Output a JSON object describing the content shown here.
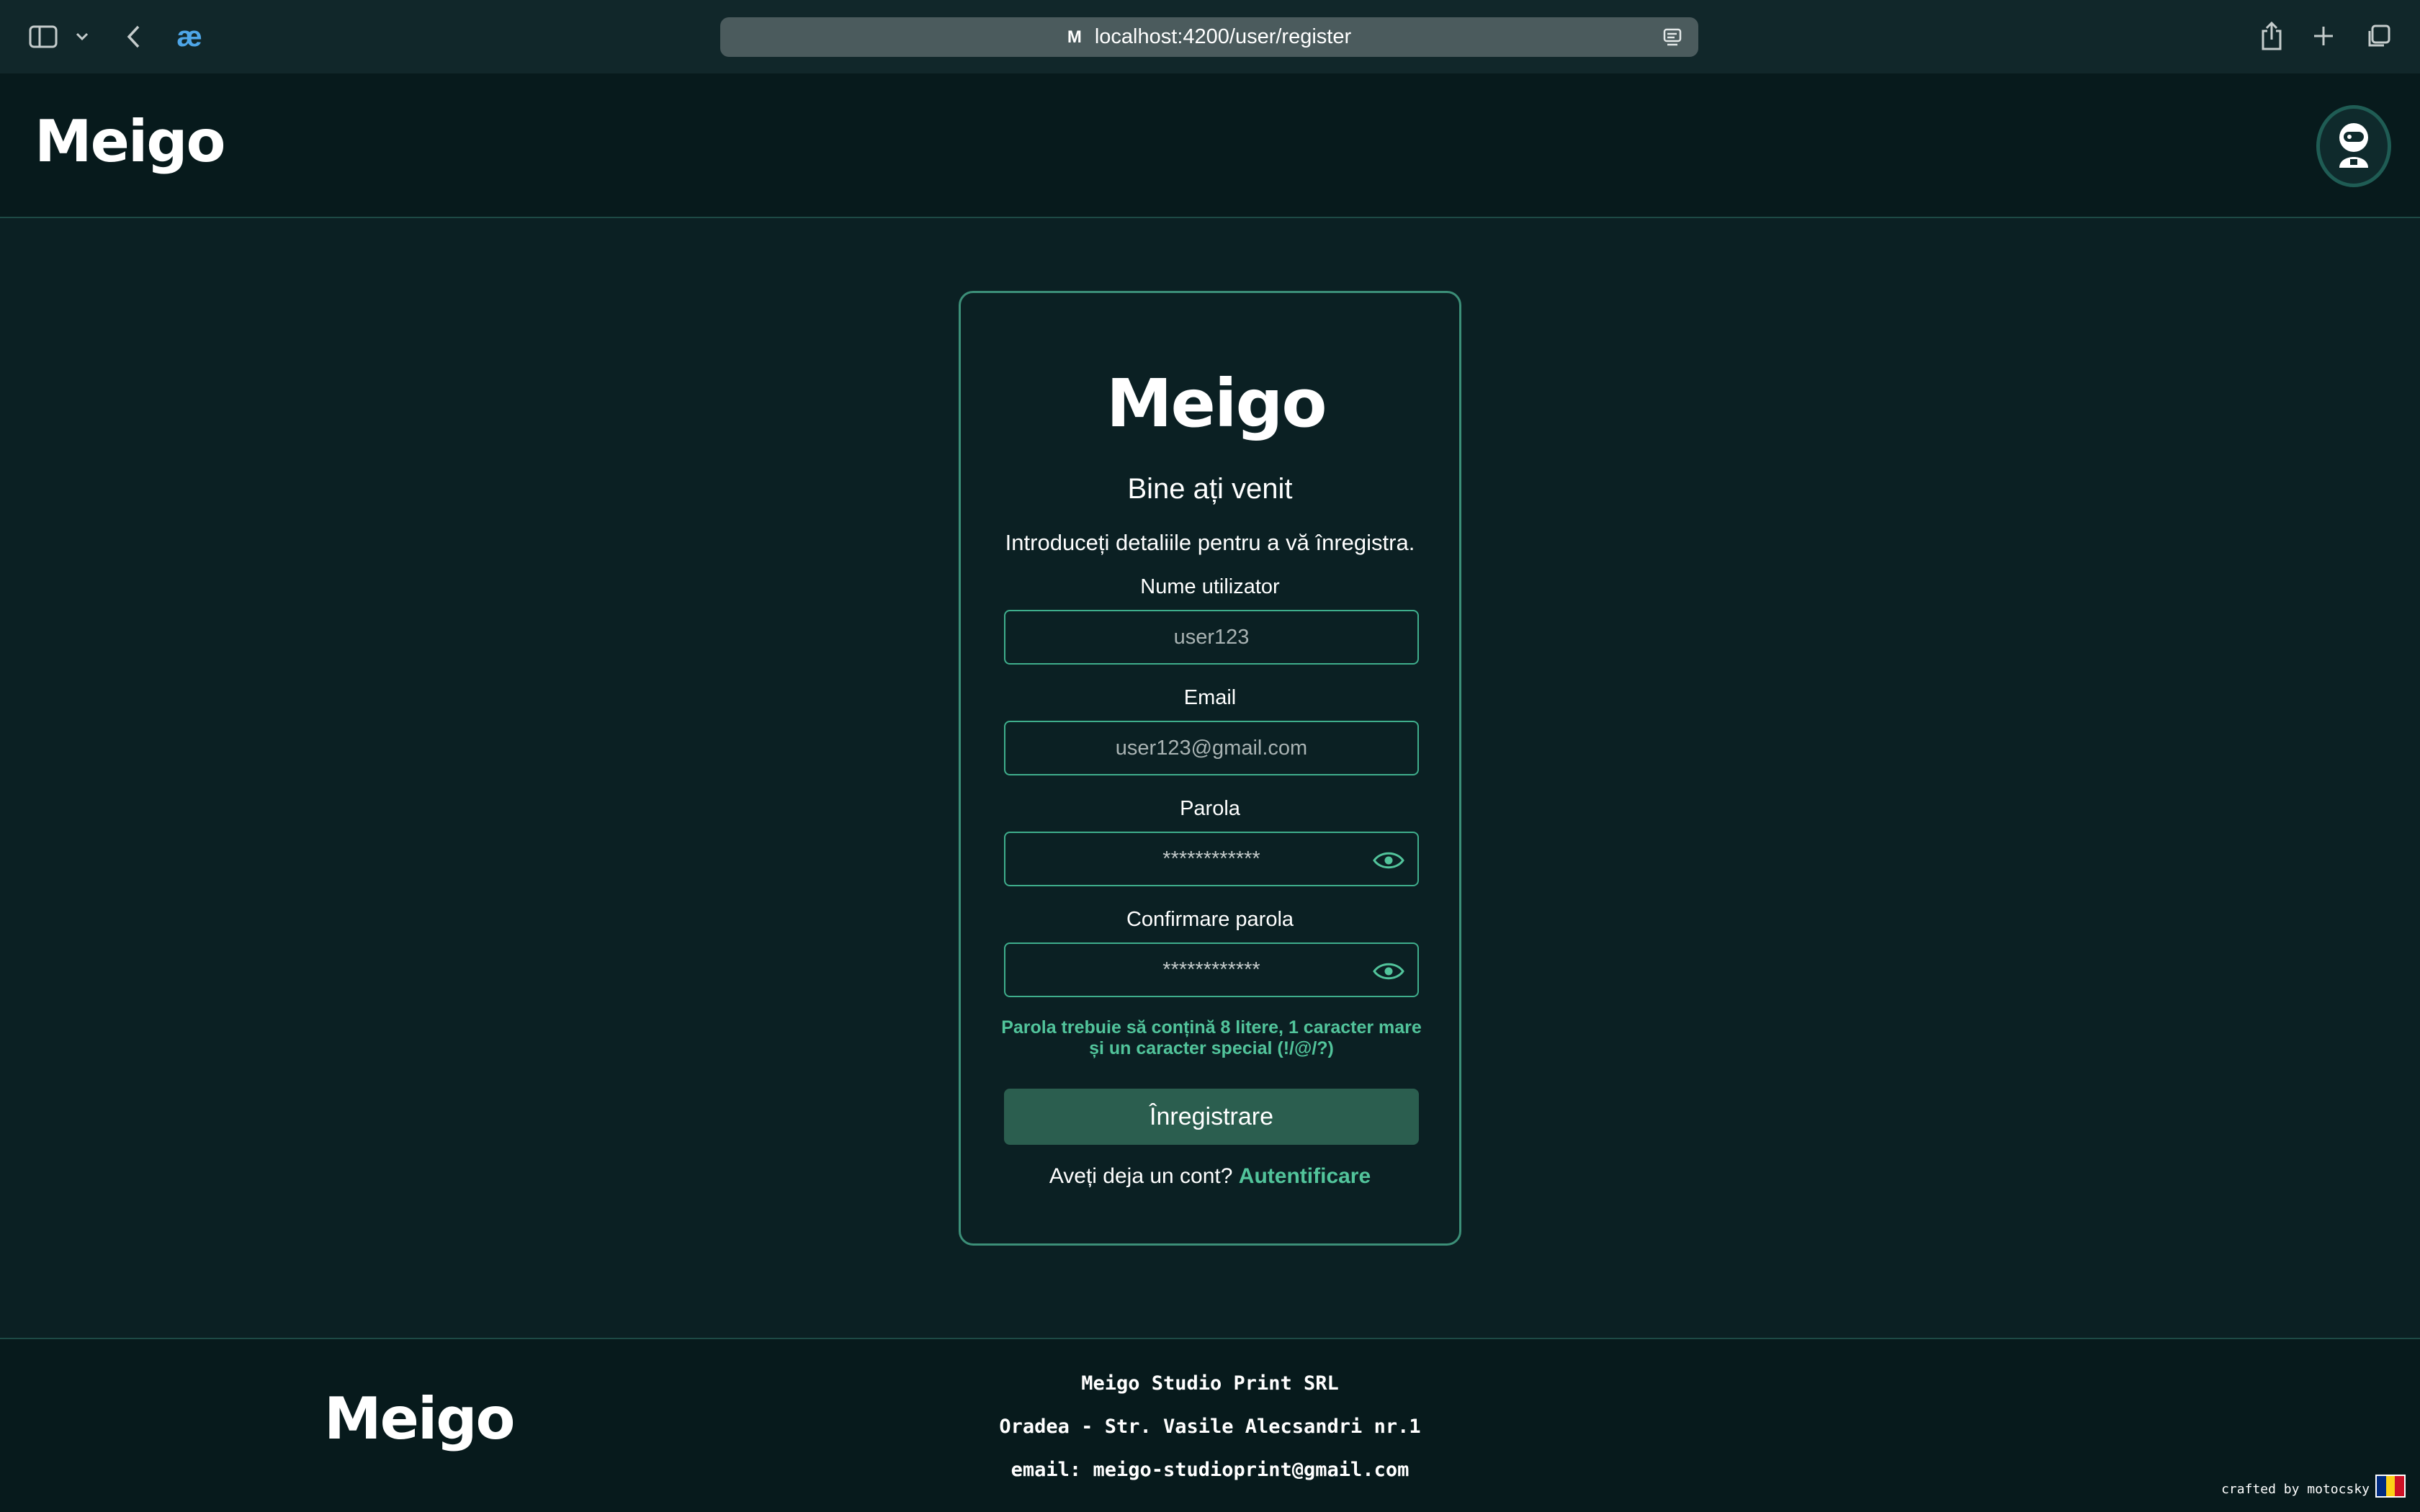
{
  "browser": {
    "url": "localhost:4200/user/register",
    "favicon": "M",
    "extension_glyph": "æ",
    "icons": [
      "sidebar-icon",
      "chevron-down-icon",
      "back-icon",
      "reader-icon",
      "share-icon",
      "plus-icon",
      "tabs-icon"
    ]
  },
  "header": {
    "logo": "Meigo",
    "avatar_icon": "astronaut-avatar-icon"
  },
  "card": {
    "logo": "Meigo",
    "title": "Bine ați venit",
    "subtitle": "Introduceți detaliile pentru a vă înregistra.",
    "fields": {
      "username": {
        "label": "Nume utilizator",
        "placeholder": "user123"
      },
      "email": {
        "label": "Email",
        "placeholder": "user123@gmail.com"
      },
      "password": {
        "label": "Parola",
        "value": "************"
      },
      "confirm": {
        "label": "Confirmare parola",
        "value": "************"
      }
    },
    "hint_line1": "Parola trebuie să conțină 8 litere, 1 caracter mare",
    "hint_line2": "și un caracter special (!/@/?)",
    "register_button": "Înregistrare",
    "login_prompt": "Aveți deja un cont?",
    "login_link": "Autentificare"
  },
  "footer": {
    "logo": "Meigo",
    "company": "Meigo Studio Print SRL",
    "address": "Oradea - Str. Vasile Alecsandri nr.1",
    "email": "email: meigo-studioprint@gmail.com",
    "crafted": "crafted by motocsky"
  },
  "colors": {
    "background": "#0b2023",
    "accent": "#52c49b",
    "button": "#2b5e4f",
    "border": "#3c8f78",
    "flag": [
      "#002b7f",
      "#fcd116",
      "#ce1126"
    ]
  }
}
